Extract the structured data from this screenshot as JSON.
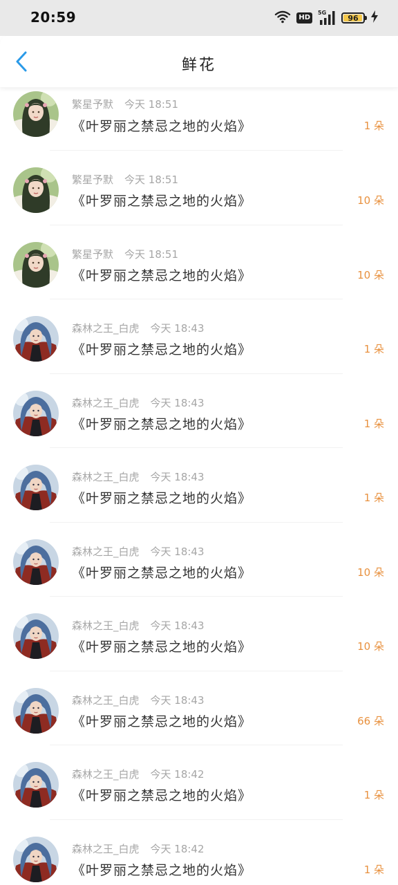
{
  "status_bar": {
    "time": "20:59",
    "hd_label": "HD",
    "network_label": "5G",
    "battery_level": 96,
    "battery_text": "96",
    "icons": [
      "wifi-icon",
      "hd-icon",
      "signal-icon",
      "battery-icon",
      "charging-icon"
    ]
  },
  "nav": {
    "title": "鲜花",
    "back_icon": "chevron-left-icon",
    "accent_color": "#2a9ae8"
  },
  "list": {
    "count_color": "#e8913f",
    "items": [
      {
        "user": "繁星予默",
        "time": "今天 18:51",
        "book": "《叶罗丽之禁忌之地的火焰》",
        "count": "1 朵",
        "avatar": "avatar-green-hair-girl"
      },
      {
        "user": "繁星予默",
        "time": "今天 18:51",
        "book": "《叶罗丽之禁忌之地的火焰》",
        "count": "10 朵",
        "avatar": "avatar-green-hair-girl"
      },
      {
        "user": "繁星予默",
        "time": "今天 18:51",
        "book": "《叶罗丽之禁忌之地的火焰》",
        "count": "10 朵",
        "avatar": "avatar-green-hair-girl"
      },
      {
        "user": "森林之王_白虎",
        "time": "今天 18:43",
        "book": "《叶罗丽之禁忌之地的火焰》",
        "count": "1 朵",
        "avatar": "avatar-blue-hair-warrior"
      },
      {
        "user": "森林之王_白虎",
        "time": "今天 18:43",
        "book": "《叶罗丽之禁忌之地的火焰》",
        "count": "1 朵",
        "avatar": "avatar-blue-hair-warrior"
      },
      {
        "user": "森林之王_白虎",
        "time": "今天 18:43",
        "book": "《叶罗丽之禁忌之地的火焰》",
        "count": "1 朵",
        "avatar": "avatar-blue-hair-warrior"
      },
      {
        "user": "森林之王_白虎",
        "time": "今天 18:43",
        "book": "《叶罗丽之禁忌之地的火焰》",
        "count": "10 朵",
        "avatar": "avatar-blue-hair-warrior"
      },
      {
        "user": "森林之王_白虎",
        "time": "今天 18:43",
        "book": "《叶罗丽之禁忌之地的火焰》",
        "count": "10 朵",
        "avatar": "avatar-blue-hair-warrior"
      },
      {
        "user": "森林之王_白虎",
        "time": "今天 18:43",
        "book": "《叶罗丽之禁忌之地的火焰》",
        "count": "66 朵",
        "avatar": "avatar-blue-hair-warrior"
      },
      {
        "user": "森林之王_白虎",
        "time": "今天 18:42",
        "book": "《叶罗丽之禁忌之地的火焰》",
        "count": "1 朵",
        "avatar": "avatar-blue-hair-warrior"
      },
      {
        "user": "森林之王_白虎",
        "time": "今天 18:42",
        "book": "《叶罗丽之禁忌之地的火焰》",
        "count": "1 朵",
        "avatar": "avatar-blue-hair-warrior"
      }
    ]
  }
}
